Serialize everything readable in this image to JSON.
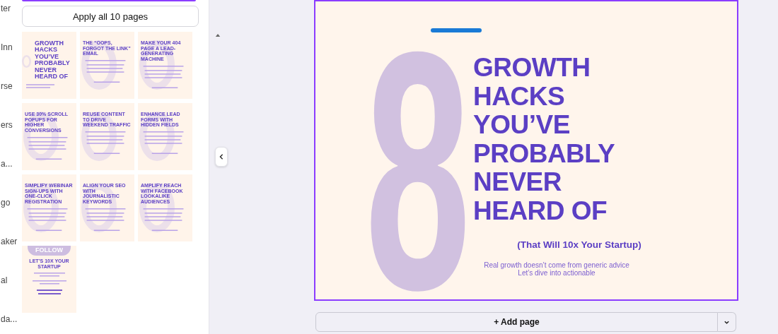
{
  "sidebar_labels": [
    "ter",
    "Inn",
    "rse",
    "ers",
    "a...",
    "go",
    "aker",
    "al",
    "da..."
  ],
  "apply_button": "Apply all 10 pages",
  "pages": [
    {
      "kind": "cover",
      "title": "GROWTH HACKS YOU’VE PROBABLY NEVER HEARD OF"
    },
    {
      "kind": "tip",
      "title": "THE “OOPS, FORGOT THE LINK” EMAIL"
    },
    {
      "kind": "tip",
      "title": "MAKE YOUR 404 PAGE A LEAD-GENERATING MACHINE"
    },
    {
      "kind": "tip",
      "title": "USE 30% SCROLL POPUPS FOR HIGHER CONVERSIONS"
    },
    {
      "kind": "tip",
      "title": "REUSE CONTENT TO DRIVE WEEKEND TRAFFIC"
    },
    {
      "kind": "tip",
      "title": "ENHANCE LEAD FORMS WITH HIDDEN FIELDS"
    },
    {
      "kind": "tip",
      "title": "SIMPLIFY WEBINAR SIGN-UPS WITH ONE-CLICK REGISTRATION"
    },
    {
      "kind": "tip",
      "title": "ALIGN YOUR SEO WITH JOURNALISTIC KEYWORDS"
    },
    {
      "kind": "tip",
      "title": "AMPLIFY REACH WITH FACEBOOK LOOKALIKE AUDIENCES"
    },
    {
      "kind": "follow",
      "badge": "FOLLOW",
      "title": "LET’S 10X YOUR STARTUP"
    }
  ],
  "canvas": {
    "selected": true,
    "numeral": "8",
    "title_lines": [
      "GROWTH",
      "HACKS",
      "YOU’VE",
      "PROBABLY",
      "NEVER",
      "HEARD OF"
    ],
    "subtitle": "(That Will 10x Your Startup)",
    "body": [
      "Real growth doesn’t come from generic advice",
      "Let’s dive into actionable"
    ]
  },
  "add_page": "+ Add page"
}
